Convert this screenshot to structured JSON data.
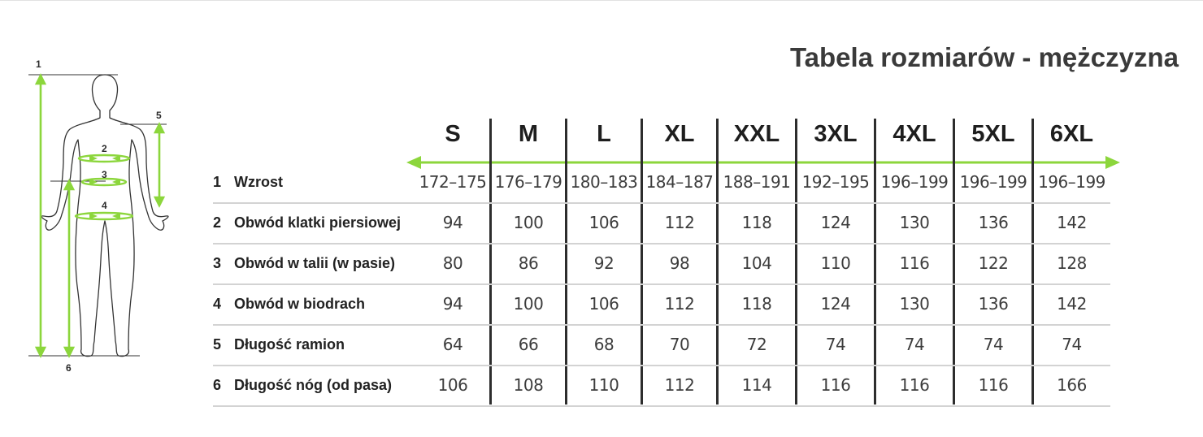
{
  "title": "Tabela rozmiarów - mężczyzna",
  "accent_color": "#8cd63c",
  "figure": {
    "icon": "human-body-outline-icon",
    "markers": [
      "1",
      "2",
      "3",
      "4",
      "5",
      "6"
    ]
  },
  "sizes": [
    "S",
    "M",
    "L",
    "XL",
    "XXL",
    "3XL",
    "4XL",
    "5XL",
    "6XL"
  ],
  "rows": [
    {
      "num": "1",
      "label": "Wzrost",
      "values": [
        "172–175",
        "176–179",
        "180–183",
        "184–187",
        "188–191",
        "192–195",
        "196–199",
        "196–199",
        "196–199"
      ]
    },
    {
      "num": "2",
      "label": "Obwód klatki piersiowej",
      "values": [
        "94",
        "100",
        "106",
        "112",
        "118",
        "124",
        "130",
        "136",
        "142"
      ]
    },
    {
      "num": "3",
      "label": "Obwód w talii (w pasie)",
      "values": [
        "80",
        "86",
        "92",
        "98",
        "104",
        "110",
        "116",
        "122",
        "128"
      ]
    },
    {
      "num": "4",
      "label": "Obwód w biodrach",
      "values": [
        "94",
        "100",
        "106",
        "112",
        "118",
        "124",
        "130",
        "136",
        "142"
      ]
    },
    {
      "num": "5",
      "label": "Długość ramion",
      "values": [
        "64",
        "66",
        "68",
        "70",
        "72",
        "74",
        "74",
        "74",
        "74"
      ]
    },
    {
      "num": "6",
      "label": "Długość nóg (od pasa)",
      "values": [
        "106",
        "108",
        "110",
        "112",
        "114",
        "116",
        "116",
        "116",
        "166"
      ]
    }
  ]
}
